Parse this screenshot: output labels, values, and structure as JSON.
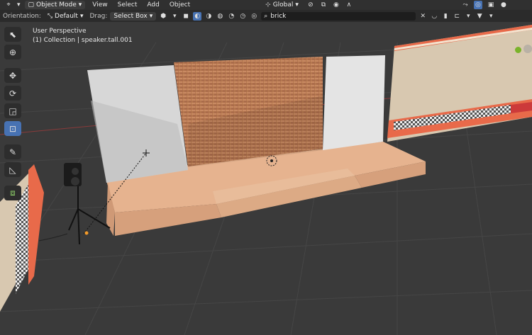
{
  "header": {
    "mode_label": "Object Mode",
    "menu": [
      "View",
      "Select",
      "Add",
      "Object"
    ],
    "transform_orientation": "Global"
  },
  "toolbar": {
    "orientation_label": "Orientation:",
    "orientation_value": "Default",
    "drag_label": "Drag:",
    "drag_value": "Select Box",
    "search_value": "brick"
  },
  "viewport": {
    "perspective_label": "User Perspective",
    "collection_label": "(1) Collection | speaker.tall.001"
  },
  "tools": [
    {
      "name": "select-box-tool",
      "icon": "cursor-arrow-icon"
    },
    {
      "name": "cursor-tool",
      "icon": "crosshair-icon"
    },
    {
      "name": "move-tool",
      "icon": "move-arrows-icon"
    },
    {
      "name": "rotate-tool",
      "icon": "rotate-icon"
    },
    {
      "name": "scale-tool",
      "icon": "scale-icon"
    },
    {
      "name": "transform-tool",
      "icon": "transform-icon"
    },
    {
      "name": "annotate-tool",
      "icon": "pencil-icon"
    },
    {
      "name": "measure-tool",
      "icon": "ruler-icon"
    },
    {
      "name": "add-cube-tool",
      "icon": "cube-add-icon"
    }
  ],
  "colors": {
    "active_tool": "#4772b3",
    "header_bg": "#303030",
    "grid_bg": "#3a3a3a"
  }
}
